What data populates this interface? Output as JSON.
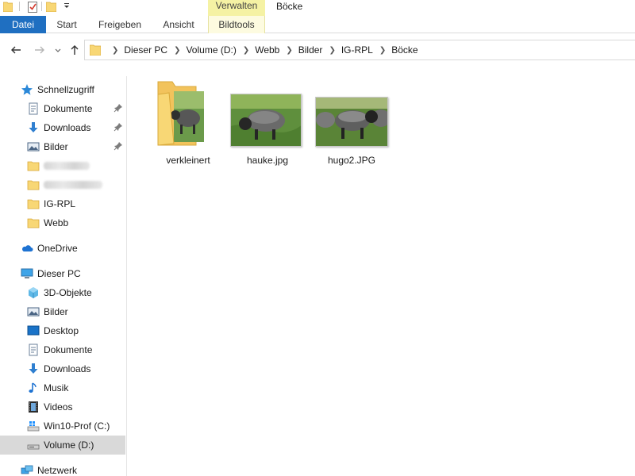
{
  "quick_access_toolbar": {
    "icons": [
      "folder-icon",
      "properties-checkmark-icon",
      "new-folder-icon",
      "customize-dropdown-icon"
    ]
  },
  "ribbon": {
    "context_group": "Verwalten",
    "window_title": "Böcke",
    "tabs": {
      "file": "Datei",
      "start": "Start",
      "share": "Freigeben",
      "view": "Ansicht",
      "picture_tools": "Bildtools"
    }
  },
  "address_bar": {
    "breadcrumb": [
      "Dieser PC",
      "Volume (D:)",
      "Webb",
      "Bilder",
      "IG-RPL",
      "Böcke"
    ]
  },
  "sidebar": {
    "quick_access": {
      "label": "Schnellzugriff",
      "items": [
        {
          "label": "Dokumente",
          "pinned": true
        },
        {
          "label": "Downloads",
          "pinned": true
        },
        {
          "label": "Bilder",
          "pinned": true
        },
        {
          "label": "",
          "blurred": true
        },
        {
          "label": "",
          "blurred": true
        },
        {
          "label": "IG-RPL",
          "pinned": false
        },
        {
          "label": "Webb",
          "pinned": false
        }
      ]
    },
    "onedrive": {
      "label": "OneDrive"
    },
    "this_pc": {
      "label": "Dieser PC",
      "items": [
        {
          "label": "3D-Objekte"
        },
        {
          "label": "Bilder"
        },
        {
          "label": "Desktop"
        },
        {
          "label": "Dokumente"
        },
        {
          "label": "Downloads"
        },
        {
          "label": "Musik"
        },
        {
          "label": "Videos"
        },
        {
          "label": "Win10-Prof (C:)"
        },
        {
          "label": "Volume (D:)",
          "selected": true
        }
      ]
    },
    "network": {
      "label": "Netzwerk"
    }
  },
  "files": [
    {
      "name": "verkleinert",
      "type": "folder"
    },
    {
      "name": "hauke.jpg",
      "type": "image"
    },
    {
      "name": "hugo2.JPG",
      "type": "image"
    }
  ],
  "colors": {
    "accent_blue": "#1f6fc1",
    "context_tab_yellow": "#f5f2a4",
    "selection_gray": "#d9d9d9",
    "folder_yellow": "#f8d775"
  }
}
